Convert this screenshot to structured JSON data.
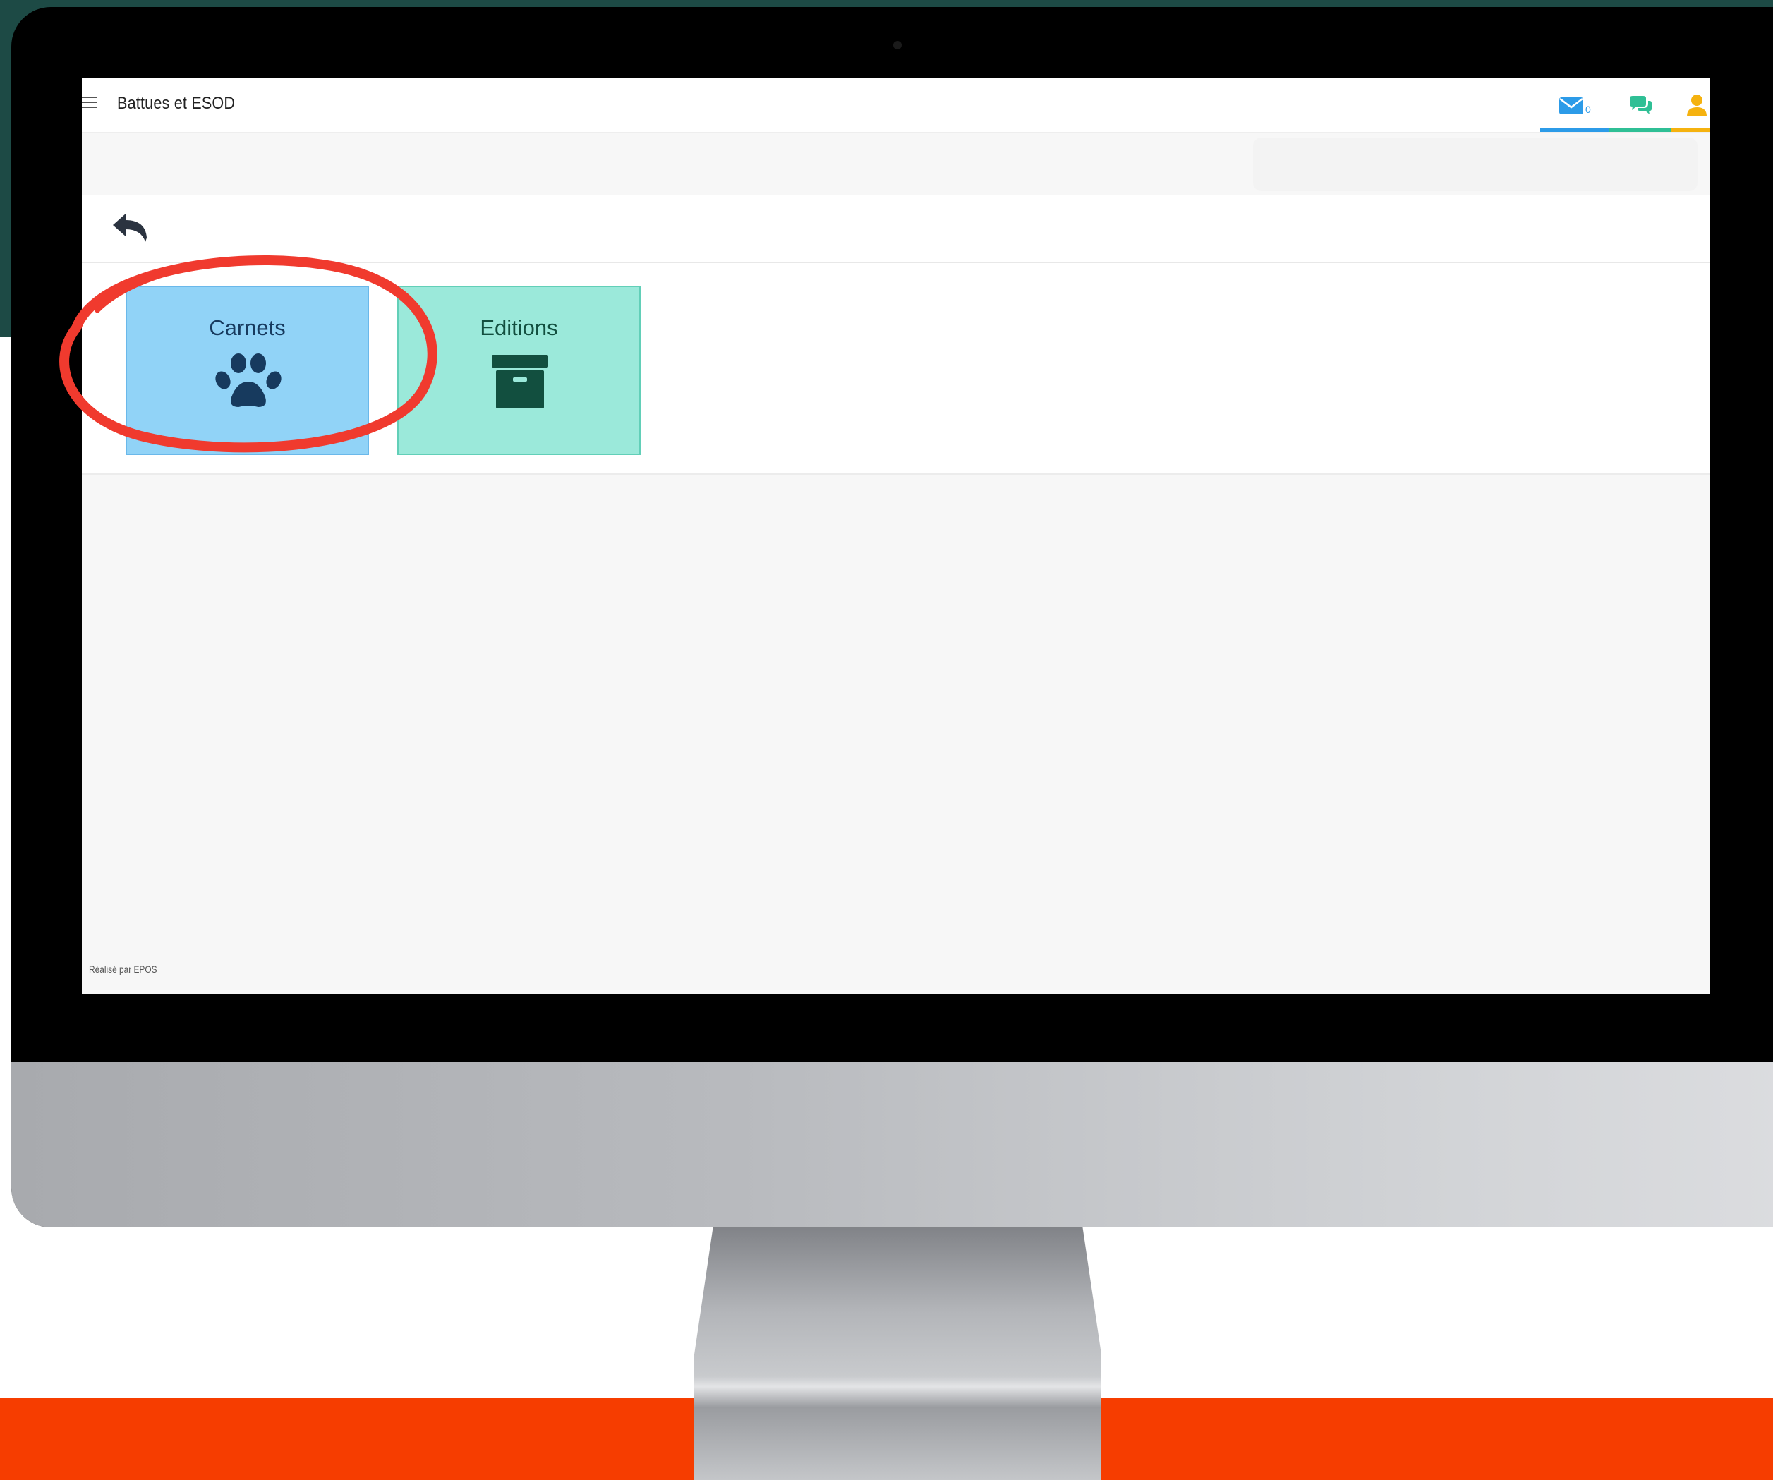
{
  "app": {
    "title": "Battues et ESOD",
    "footer": "Réalisé par EPOS"
  },
  "topbar": {
    "mail_count": "0",
    "icons": [
      "envelope-icon",
      "chat-icon",
      "user-icon"
    ],
    "colors": {
      "mail": "#2c9be8",
      "chat": "#2fbf95",
      "user": "#f5b20f"
    }
  },
  "tiles": [
    {
      "label": "Carnets",
      "icon": "paw-icon",
      "color": "#91d3f7"
    },
    {
      "label": "Editions",
      "icon": "archive-box-icon",
      "color": "#9be9da"
    }
  ],
  "annotation": {
    "color": "#f03a2e",
    "target": "Carnets"
  },
  "backdrop": {
    "top_color": "#1d4a45",
    "bottom_color": "#f63d00"
  }
}
